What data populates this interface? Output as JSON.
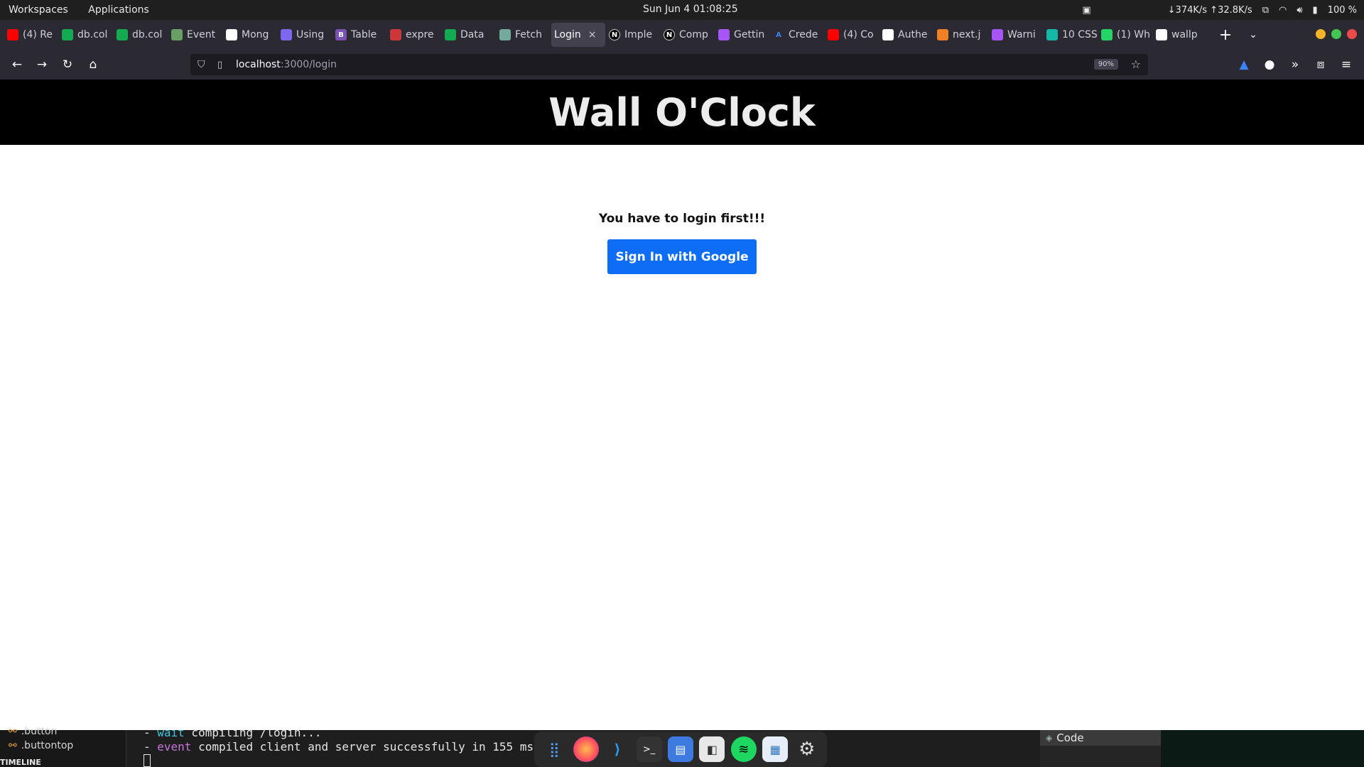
{
  "system_bar": {
    "menu": [
      "Workspaces",
      "Applications"
    ],
    "clock": "Sun Jun 4  01:08:25",
    "net_speed": "↓374K/s ↑32.8K/s",
    "battery": "100 %"
  },
  "tabs": [
    {
      "label": "(4) Re",
      "icon": "youtube-icon",
      "color": "#ff0000"
    },
    {
      "label": "db.col",
      "icon": "mongodb-icon",
      "color": "#13aa52"
    },
    {
      "label": "db.col",
      "icon": "mongodb-icon",
      "color": "#13aa52"
    },
    {
      "label": "Event",
      "icon": "nodejs-icon",
      "color": "#68a063"
    },
    {
      "label": "Mong",
      "icon": "medium-icon",
      "color": "#ffffff"
    },
    {
      "label": "Using",
      "icon": "site-icon",
      "color": "#7b68ee"
    },
    {
      "label": "Table",
      "icon": "bootstrap-icon",
      "color": "#7952b3"
    },
    {
      "label": "expre",
      "icon": "npm-icon",
      "color": "#cb3837"
    },
    {
      "label": "Data",
      "icon": "mongodb-icon",
      "color": "#13aa52"
    },
    {
      "label": "Fetch",
      "icon": "chatgpt-icon",
      "color": "#74aa9c"
    },
    {
      "label": "Login",
      "icon": "",
      "color": "",
      "active": true
    },
    {
      "label": "Imple",
      "icon": "nextjs-icon",
      "color": "#000000"
    },
    {
      "label": "Comp",
      "icon": "nextjs-icon",
      "color": "#000000"
    },
    {
      "label": "Gettin",
      "icon": "site-icon",
      "color": "#a855f7"
    },
    {
      "label": "Crede",
      "icon": "api-icon",
      "color": "#3b82f6"
    },
    {
      "label": "(4) Co",
      "icon": "youtube-icon",
      "color": "#ff0000"
    },
    {
      "label": "Authe",
      "icon": "github-icon",
      "color": "#ffffff"
    },
    {
      "label": "next.j",
      "icon": "stackoverflow-icon",
      "color": "#f48024"
    },
    {
      "label": "Warni",
      "icon": "site-icon",
      "color": "#a855f7"
    },
    {
      "label": "10 CSS",
      "icon": "site-icon",
      "color": "#14b8a6"
    },
    {
      "label": "(1) Wh",
      "icon": "whatsapp-icon",
      "color": "#25d366"
    },
    {
      "label": "wallp",
      "icon": "google-icon",
      "color": "#ffffff"
    }
  ],
  "nav": {
    "url_host": "localhost",
    "url_rest": ":3000/login",
    "zoom": "90%"
  },
  "page": {
    "title": "Wall O'Clock",
    "message": "You have to login first!!!",
    "signin_label": "Sign In with Google",
    "signin_color": "#0d6ef5"
  },
  "editor": {
    "outline_items": [
      ".button",
      ".buttontop"
    ],
    "timeline": "TIMELINE",
    "terminal_lines": [
      {
        "keyword": "wait",
        "text": " compiling /login..."
      },
      {
        "keyword": "event",
        "text": " compiled client and server successfully in 155 ms"
      }
    ],
    "code_tab": "Code"
  },
  "dock_apps": [
    "apps-grid-icon",
    "firefox-icon",
    "vscode-icon",
    "terminal-icon",
    "files-icon",
    "libreoffice-icon",
    "spotify-icon",
    "writer-icon",
    "settings-icon"
  ]
}
